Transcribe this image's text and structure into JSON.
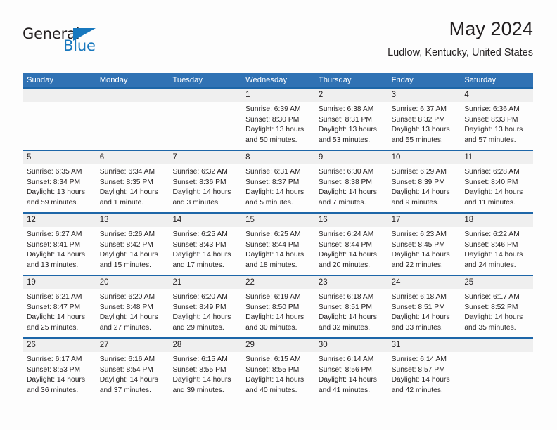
{
  "brand": {
    "name_part1": "General",
    "name_part2": "Blue",
    "flag_icon": "triangle-flag-icon"
  },
  "header": {
    "title": "May 2024",
    "subtitle": "Ludlow, Kentucky, United States"
  },
  "calendar": {
    "weekdays": [
      "Sunday",
      "Monday",
      "Tuesday",
      "Wednesday",
      "Thursday",
      "Friday",
      "Saturday"
    ],
    "colors": {
      "header_blue": "#3072b4",
      "divider_blue": "#1d66a8",
      "number_band": "#efefef",
      "text": "#231f20",
      "brand_blue": "#1878be"
    },
    "weeks": [
      {
        "days": [
          {
            "num": "",
            "sunrise": "",
            "sunset": "",
            "daylight1": "",
            "daylight2": ""
          },
          {
            "num": "",
            "sunrise": "",
            "sunset": "",
            "daylight1": "",
            "daylight2": ""
          },
          {
            "num": "",
            "sunrise": "",
            "sunset": "",
            "daylight1": "",
            "daylight2": ""
          },
          {
            "num": "1",
            "sunrise": "Sunrise: 6:39 AM",
            "sunset": "Sunset: 8:30 PM",
            "daylight1": "Daylight: 13 hours",
            "daylight2": "and 50 minutes."
          },
          {
            "num": "2",
            "sunrise": "Sunrise: 6:38 AM",
            "sunset": "Sunset: 8:31 PM",
            "daylight1": "Daylight: 13 hours",
            "daylight2": "and 53 minutes."
          },
          {
            "num": "3",
            "sunrise": "Sunrise: 6:37 AM",
            "sunset": "Sunset: 8:32 PM",
            "daylight1": "Daylight: 13 hours",
            "daylight2": "and 55 minutes."
          },
          {
            "num": "4",
            "sunrise": "Sunrise: 6:36 AM",
            "sunset": "Sunset: 8:33 PM",
            "daylight1": "Daylight: 13 hours",
            "daylight2": "and 57 minutes."
          }
        ]
      },
      {
        "days": [
          {
            "num": "5",
            "sunrise": "Sunrise: 6:35 AM",
            "sunset": "Sunset: 8:34 PM",
            "daylight1": "Daylight: 13 hours",
            "daylight2": "and 59 minutes."
          },
          {
            "num": "6",
            "sunrise": "Sunrise: 6:34 AM",
            "sunset": "Sunset: 8:35 PM",
            "daylight1": "Daylight: 14 hours",
            "daylight2": "and 1 minute."
          },
          {
            "num": "7",
            "sunrise": "Sunrise: 6:32 AM",
            "sunset": "Sunset: 8:36 PM",
            "daylight1": "Daylight: 14 hours",
            "daylight2": "and 3 minutes."
          },
          {
            "num": "8",
            "sunrise": "Sunrise: 6:31 AM",
            "sunset": "Sunset: 8:37 PM",
            "daylight1": "Daylight: 14 hours",
            "daylight2": "and 5 minutes."
          },
          {
            "num": "9",
            "sunrise": "Sunrise: 6:30 AM",
            "sunset": "Sunset: 8:38 PM",
            "daylight1": "Daylight: 14 hours",
            "daylight2": "and 7 minutes."
          },
          {
            "num": "10",
            "sunrise": "Sunrise: 6:29 AM",
            "sunset": "Sunset: 8:39 PM",
            "daylight1": "Daylight: 14 hours",
            "daylight2": "and 9 minutes."
          },
          {
            "num": "11",
            "sunrise": "Sunrise: 6:28 AM",
            "sunset": "Sunset: 8:40 PM",
            "daylight1": "Daylight: 14 hours",
            "daylight2": "and 11 minutes."
          }
        ]
      },
      {
        "days": [
          {
            "num": "12",
            "sunrise": "Sunrise: 6:27 AM",
            "sunset": "Sunset: 8:41 PM",
            "daylight1": "Daylight: 14 hours",
            "daylight2": "and 13 minutes."
          },
          {
            "num": "13",
            "sunrise": "Sunrise: 6:26 AM",
            "sunset": "Sunset: 8:42 PM",
            "daylight1": "Daylight: 14 hours",
            "daylight2": "and 15 minutes."
          },
          {
            "num": "14",
            "sunrise": "Sunrise: 6:25 AM",
            "sunset": "Sunset: 8:43 PM",
            "daylight1": "Daylight: 14 hours",
            "daylight2": "and 17 minutes."
          },
          {
            "num": "15",
            "sunrise": "Sunrise: 6:25 AM",
            "sunset": "Sunset: 8:44 PM",
            "daylight1": "Daylight: 14 hours",
            "daylight2": "and 18 minutes."
          },
          {
            "num": "16",
            "sunrise": "Sunrise: 6:24 AM",
            "sunset": "Sunset: 8:44 PM",
            "daylight1": "Daylight: 14 hours",
            "daylight2": "and 20 minutes."
          },
          {
            "num": "17",
            "sunrise": "Sunrise: 6:23 AM",
            "sunset": "Sunset: 8:45 PM",
            "daylight1": "Daylight: 14 hours",
            "daylight2": "and 22 minutes."
          },
          {
            "num": "18",
            "sunrise": "Sunrise: 6:22 AM",
            "sunset": "Sunset: 8:46 PM",
            "daylight1": "Daylight: 14 hours",
            "daylight2": "and 24 minutes."
          }
        ]
      },
      {
        "days": [
          {
            "num": "19",
            "sunrise": "Sunrise: 6:21 AM",
            "sunset": "Sunset: 8:47 PM",
            "daylight1": "Daylight: 14 hours",
            "daylight2": "and 25 minutes."
          },
          {
            "num": "20",
            "sunrise": "Sunrise: 6:20 AM",
            "sunset": "Sunset: 8:48 PM",
            "daylight1": "Daylight: 14 hours",
            "daylight2": "and 27 minutes."
          },
          {
            "num": "21",
            "sunrise": "Sunrise: 6:20 AM",
            "sunset": "Sunset: 8:49 PM",
            "daylight1": "Daylight: 14 hours",
            "daylight2": "and 29 minutes."
          },
          {
            "num": "22",
            "sunrise": "Sunrise: 6:19 AM",
            "sunset": "Sunset: 8:50 PM",
            "daylight1": "Daylight: 14 hours",
            "daylight2": "and 30 minutes."
          },
          {
            "num": "23",
            "sunrise": "Sunrise: 6:18 AM",
            "sunset": "Sunset: 8:51 PM",
            "daylight1": "Daylight: 14 hours",
            "daylight2": "and 32 minutes."
          },
          {
            "num": "24",
            "sunrise": "Sunrise: 6:18 AM",
            "sunset": "Sunset: 8:51 PM",
            "daylight1": "Daylight: 14 hours",
            "daylight2": "and 33 minutes."
          },
          {
            "num": "25",
            "sunrise": "Sunrise: 6:17 AM",
            "sunset": "Sunset: 8:52 PM",
            "daylight1": "Daylight: 14 hours",
            "daylight2": "and 35 minutes."
          }
        ]
      },
      {
        "days": [
          {
            "num": "26",
            "sunrise": "Sunrise: 6:17 AM",
            "sunset": "Sunset: 8:53 PM",
            "daylight1": "Daylight: 14 hours",
            "daylight2": "and 36 minutes."
          },
          {
            "num": "27",
            "sunrise": "Sunrise: 6:16 AM",
            "sunset": "Sunset: 8:54 PM",
            "daylight1": "Daylight: 14 hours",
            "daylight2": "and 37 minutes."
          },
          {
            "num": "28",
            "sunrise": "Sunrise: 6:15 AM",
            "sunset": "Sunset: 8:55 PM",
            "daylight1": "Daylight: 14 hours",
            "daylight2": "and 39 minutes."
          },
          {
            "num": "29",
            "sunrise": "Sunrise: 6:15 AM",
            "sunset": "Sunset: 8:55 PM",
            "daylight1": "Daylight: 14 hours",
            "daylight2": "and 40 minutes."
          },
          {
            "num": "30",
            "sunrise": "Sunrise: 6:14 AM",
            "sunset": "Sunset: 8:56 PM",
            "daylight1": "Daylight: 14 hours",
            "daylight2": "and 41 minutes."
          },
          {
            "num": "31",
            "sunrise": "Sunrise: 6:14 AM",
            "sunset": "Sunset: 8:57 PM",
            "daylight1": "Daylight: 14 hours",
            "daylight2": "and 42 minutes."
          },
          {
            "num": "",
            "sunrise": "",
            "sunset": "",
            "daylight1": "",
            "daylight2": ""
          }
        ]
      }
    ]
  }
}
